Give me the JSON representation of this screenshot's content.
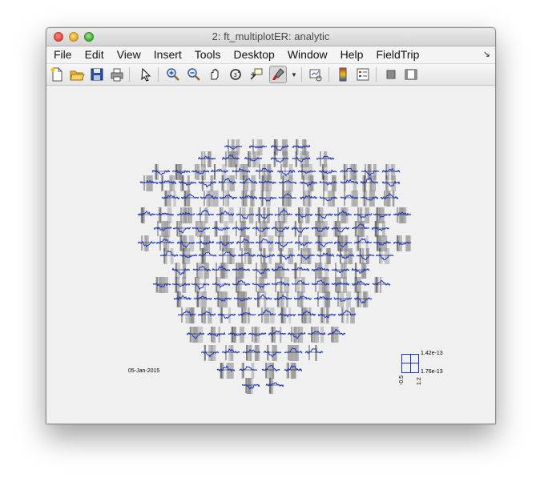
{
  "window": {
    "title": "2: ft_multiplotER: analytic"
  },
  "menubar": {
    "items": [
      "File",
      "Edit",
      "View",
      "Insert",
      "Tools",
      "Desktop",
      "Window",
      "Help",
      "FieldTrip"
    ],
    "overflow_icon": "dock-arrow-icon"
  },
  "toolbar": {
    "icons": [
      "new-figure-icon",
      "open-file-icon",
      "save-icon",
      "print-icon",
      "pointer-icon",
      "zoom-in-icon",
      "zoom-out-icon",
      "pan-icon",
      "rotate-icon",
      "data-cursor-icon",
      "brush-icon",
      "brush-dropdown-icon",
      "link-plot-icon",
      "colorbar-icon",
      "legend-icon",
      "hide-plot-tools-icon",
      "show-plot-tools-icon"
    ]
  },
  "figure": {
    "date": "05-Jan-2015",
    "scale_labels": {
      "y_max": "1.42e-13",
      "y_min": "1.76e-13",
      "x_min": "-0.5",
      "x_max": "1.2"
    },
    "colors": {
      "trace": "#1a33c8",
      "background": "#f0f0f0",
      "shade": "#8c8c8c"
    }
  }
}
